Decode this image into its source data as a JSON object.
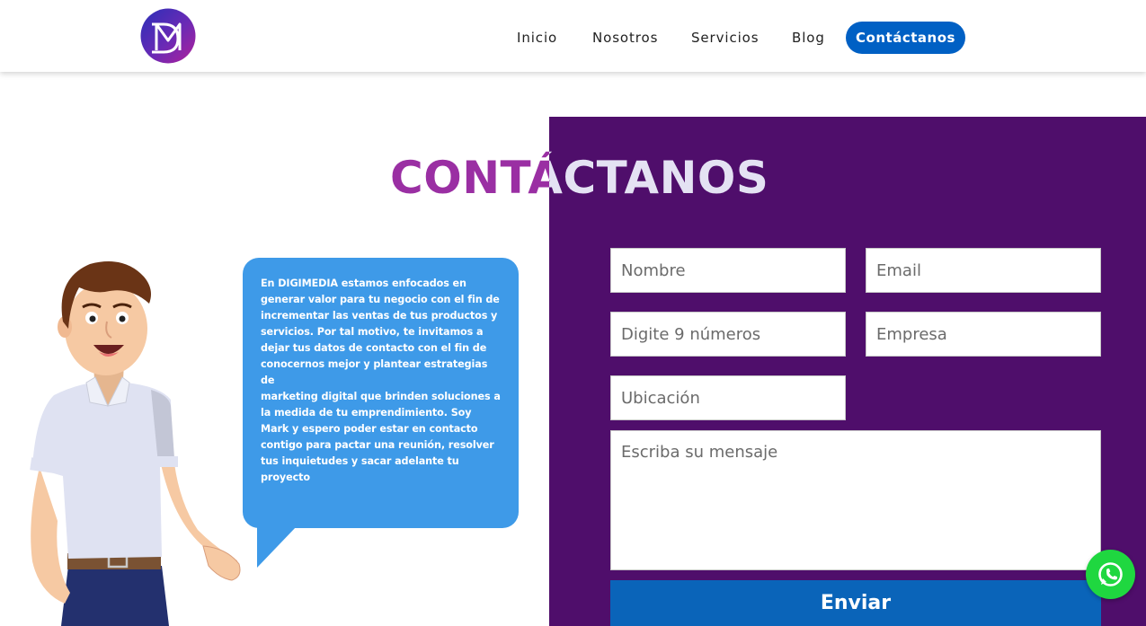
{
  "brand": {
    "logo_text": "DM",
    "accent": "#0060c4",
    "panel": "#4f0e6b",
    "title_color": "#9a2fa3",
    "bubble": "#3e9ae8"
  },
  "nav": {
    "items": [
      {
        "label": "Inicio"
      },
      {
        "label": "Nosotros"
      },
      {
        "label": "Servicios"
      },
      {
        "label": "Blog"
      }
    ],
    "cta": "Contáctanos"
  },
  "page": {
    "title": "CONTÁCTANOS"
  },
  "bubble": {
    "lines": [
      "En DIGIMEDIA estamos enfocados en",
      "generar valor para tu negocio con el fin de",
      "incrementar las ventas de tus productos y",
      "servicios. Por tal motivo, te invitamos a",
      "dejar tus datos de contacto con el fin de",
      "conocernos mejor y plantear estrategias de",
      "marketing digital que brinden soluciones a",
      "la medida de tu emprendimiento. Soy",
      "Mark y espero poder estar en contacto",
      "contigo para pactar una reunión, resolver",
      "tus inquietudes y sacar adelante tu",
      "proyecto"
    ]
  },
  "form": {
    "name_placeholder": "Nombre",
    "email_placeholder": "Email",
    "phone_placeholder": "Digite 9 números",
    "company_placeholder": "Empresa",
    "location_placeholder": "Ubicación",
    "message_placeholder": "Escriba su mensaje",
    "submit_label": "Enviar"
  },
  "whatsapp": {
    "icon": "whatsapp-icon",
    "color": "#1fd740"
  }
}
